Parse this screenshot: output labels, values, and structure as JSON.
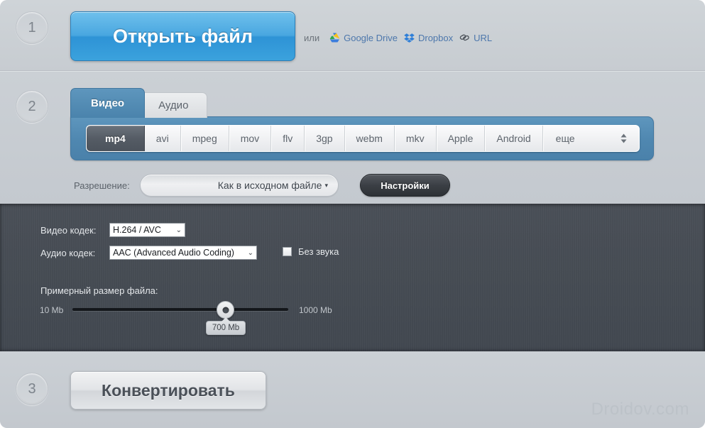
{
  "steps": {
    "one": "1",
    "two": "2",
    "three": "3"
  },
  "step1": {
    "open_file_button": "Открыть файл",
    "or_text": "или",
    "cloud_links": [
      {
        "label": "Google Drive",
        "icon": "google-drive-icon"
      },
      {
        "label": "Dropbox",
        "icon": "dropbox-icon"
      },
      {
        "label": "URL",
        "icon": "link-icon"
      }
    ]
  },
  "step2": {
    "tabs": [
      {
        "label": "Видео",
        "active": true
      },
      {
        "label": "Аудио",
        "active": false
      }
    ],
    "formats": [
      {
        "label": "mp4",
        "selected": true
      },
      {
        "label": "avi",
        "selected": false
      },
      {
        "label": "mpeg",
        "selected": false
      },
      {
        "label": "mov",
        "selected": false
      },
      {
        "label": "flv",
        "selected": false
      },
      {
        "label": "3gp",
        "selected": false
      },
      {
        "label": "webm",
        "selected": false
      },
      {
        "label": "mkv",
        "selected": false
      },
      {
        "label": "Apple",
        "selected": false
      },
      {
        "label": "Android",
        "selected": false
      }
    ],
    "more_label": "еще",
    "more_icon": "spinner-updown-icon",
    "resolution_label": "Разрешение:",
    "resolution_value": "Как в исходном файле",
    "resolution_caret": "▾",
    "settings_button": "Настройки"
  },
  "settings_panel": {
    "video_codec_label": "Видео кодек:",
    "video_codec_value": "H.264 / AVC",
    "audio_codec_label": "Аудио кодек:",
    "audio_codec_value": "AAC (Advanced Audio Coding)",
    "mute_label": "Без звука",
    "mute_checked": false,
    "filesize_title": "Примерный размер файла:",
    "slider": {
      "min_label": "10 Mb",
      "max_label": "1000 Mb",
      "current_label": "700 Mb",
      "min": 10,
      "max": 1000,
      "value": 700
    }
  },
  "step3": {
    "convert_button": "Конвертировать"
  },
  "watermark": "Droidov.com",
  "colors": {
    "accent_blue": "#49a7e0",
    "tab_blue": "#4f87b0",
    "panel_dark": "#464c54",
    "link_blue": "#4d77ac",
    "page_bg": "#c9ced3"
  }
}
